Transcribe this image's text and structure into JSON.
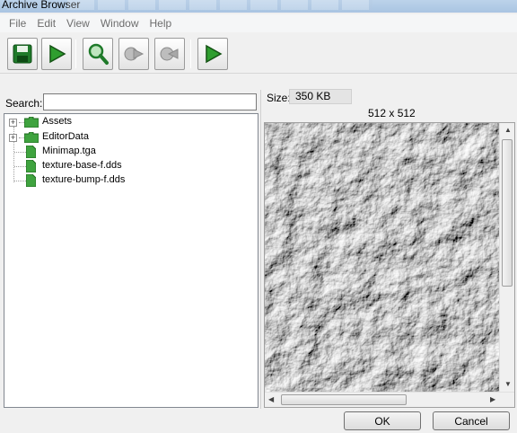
{
  "window": {
    "title": "Archive Browser"
  },
  "menu": [
    "File",
    "Edit",
    "View",
    "Window",
    "Help"
  ],
  "toolbar": {
    "buttons": [
      {
        "name": "save-button",
        "icon": "floppy-disk-icon",
        "enabled": true
      },
      {
        "name": "play-button",
        "icon": "play-arrow-icon",
        "enabled": true
      },
      {
        "name": "search-button",
        "icon": "magnifier-icon",
        "enabled": true
      },
      {
        "name": "export-button",
        "icon": "export-icon",
        "enabled": false
      },
      {
        "name": "import-button",
        "icon": "import-icon",
        "enabled": false
      },
      {
        "name": "run-button",
        "icon": "play-arrow-icon",
        "enabled": true
      }
    ]
  },
  "search": {
    "label": "Search:",
    "value": ""
  },
  "tree": [
    {
      "label": "Assets",
      "type": "folder",
      "expandable": true
    },
    {
      "label": "EditorData",
      "type": "folder",
      "expandable": true
    },
    {
      "label": "Minimap.tga",
      "type": "file",
      "expandable": false
    },
    {
      "label": "texture-base-f.dds",
      "type": "file",
      "expandable": false
    },
    {
      "label": "texture-bump-f.dds",
      "type": "file",
      "expandable": false
    }
  ],
  "preview": {
    "size_label": "Size:",
    "size_value": "350 KB",
    "dimensions": "512 x 512"
  },
  "buttons": {
    "ok": "OK",
    "cancel": "Cancel"
  },
  "colors": {
    "folder": "#3fa33f",
    "play": "#2f9e2f",
    "disabled_icon": "#a8a8a8"
  }
}
